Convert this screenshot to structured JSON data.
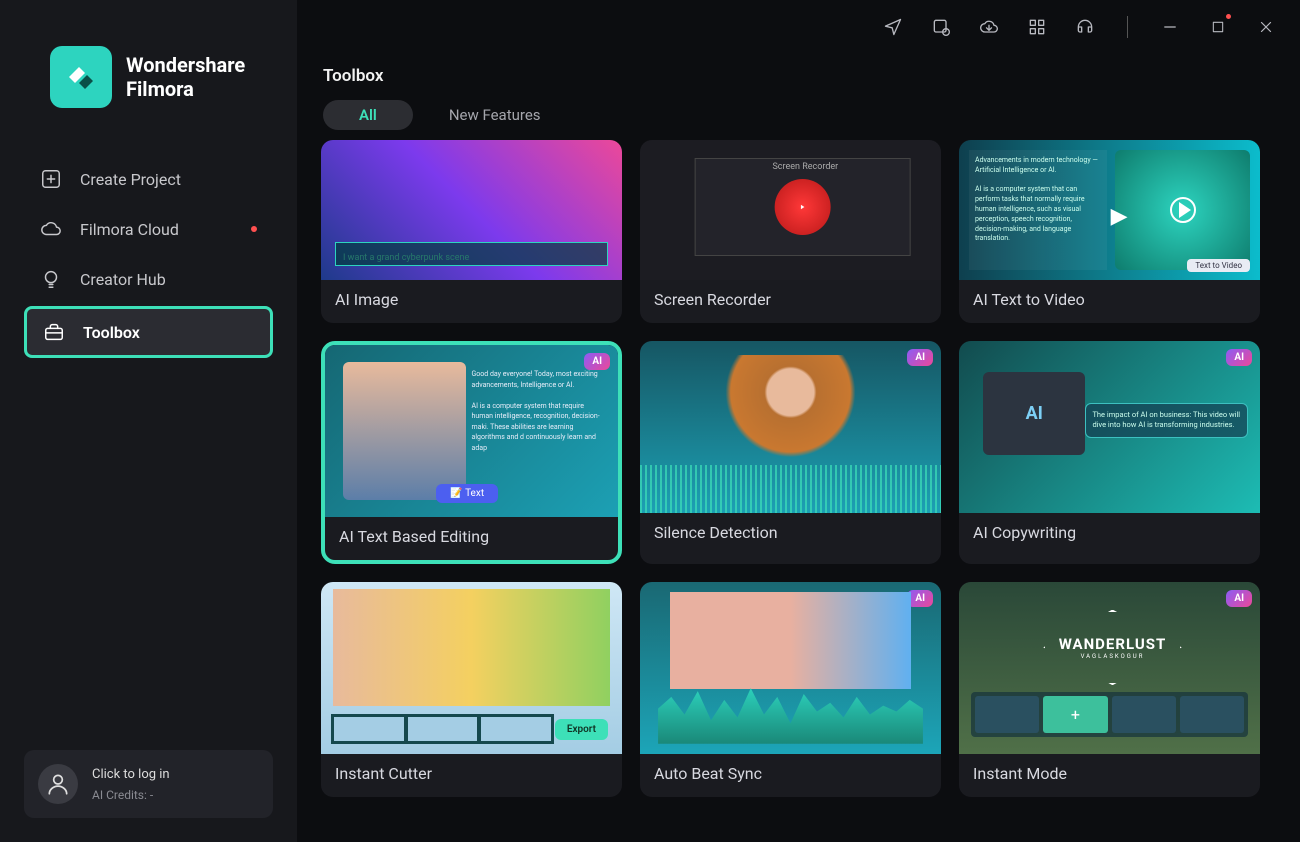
{
  "app": {
    "brand_line1": "Wondershare",
    "brand_line2": "Filmora"
  },
  "sidebar": {
    "items": [
      {
        "label": "Create Project"
      },
      {
        "label": "Filmora Cloud"
      },
      {
        "label": "Creator Hub"
      },
      {
        "label": "Toolbox"
      }
    ]
  },
  "footer": {
    "login_prompt": "Click to log in",
    "credits_label": "AI Credits: -"
  },
  "page": {
    "title": "Toolbox"
  },
  "tabs": [
    {
      "label": "All"
    },
    {
      "label": "New Features"
    }
  ],
  "tools": [
    {
      "label": "AI Image",
      "has_ai_badge": false,
      "caption": "I want a grand cyberpunk scene"
    },
    {
      "label": "Screen Recorder",
      "has_ai_badge": false,
      "caption": "Screen Recorder"
    },
    {
      "label": "AI Text to Video",
      "has_ai_badge": false,
      "text1": "Advancements in modern technology — Artificial Intelligence or AI.",
      "text2": "AI is a computer system that can perform tasks that normally require human intelligence, such as visual perception, speech recognition, decision-making, and language translation.",
      "pill": "Text to Video"
    },
    {
      "label": "AI Text Based Editing",
      "has_ai_badge": true,
      "text1": "Good day everyone! Today, most exciting advancements, Intelligence or AI.",
      "text2": "AI is a computer system that require human intelligence, recognition, decision-maki. These abilities are learning algorithms and d continuously learn and adap",
      "button": "Text"
    },
    {
      "label": "Silence Detection",
      "has_ai_badge": true
    },
    {
      "label": "AI Copywriting",
      "has_ai_badge": true,
      "chip_label": "AI",
      "bubble": "The impact of AI on business: This video will dive into how AI is transforming industries."
    },
    {
      "label": "Instant Cutter",
      "has_ai_badge": false,
      "button": "Export"
    },
    {
      "label": "Auto Beat Sync",
      "has_ai_badge": true
    },
    {
      "label": "Instant Mode",
      "has_ai_badge": true,
      "title": "WANDERLUST",
      "sub": "VAGLASKOGUR"
    }
  ],
  "badges": {
    "ai": "AI"
  }
}
